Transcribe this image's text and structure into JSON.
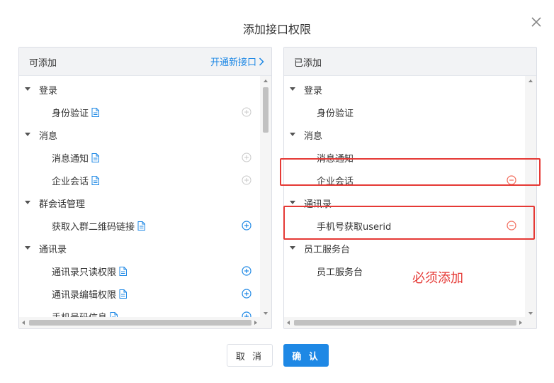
{
  "dialog": {
    "title": "添加接口权限",
    "cancel_label": "取 消",
    "confirm_label": "确 认"
  },
  "left_panel": {
    "title": "可添加",
    "open_link": "开通新接口",
    "items": [
      {
        "type": "parent",
        "label": "登录"
      },
      {
        "type": "child",
        "label": "身份验证",
        "action": "add-disabled"
      },
      {
        "type": "parent",
        "label": "消息"
      },
      {
        "type": "child",
        "label": "消息通知",
        "action": "add-disabled"
      },
      {
        "type": "child",
        "label": "企业会话",
        "action": "add-disabled"
      },
      {
        "type": "parent",
        "label": "群会话管理"
      },
      {
        "type": "child",
        "label": "获取入群二维码链接",
        "action": "add"
      },
      {
        "type": "parent",
        "label": "通讯录"
      },
      {
        "type": "child",
        "label": "通讯录只读权限",
        "action": "add"
      },
      {
        "type": "child",
        "label": "通讯录编辑权限",
        "action": "add"
      },
      {
        "type": "child",
        "label": "手机号码信息",
        "action": "add"
      }
    ]
  },
  "right_panel": {
    "title": "已添加",
    "items": [
      {
        "type": "parent",
        "label": "登录"
      },
      {
        "type": "child",
        "label": "身份验证",
        "action": "none"
      },
      {
        "type": "parent",
        "label": "消息"
      },
      {
        "type": "child",
        "label": "消息通知",
        "action": "none"
      },
      {
        "type": "child",
        "label": "企业会话",
        "action": "remove"
      },
      {
        "type": "parent",
        "label": "通讯录"
      },
      {
        "type": "child",
        "label": "手机号获取userid",
        "action": "remove"
      },
      {
        "type": "parent",
        "label": "员工服务台"
      },
      {
        "type": "child",
        "label": "员工服务台",
        "action": "none"
      }
    ]
  },
  "annotation": {
    "note": "必须添加",
    "color": "#e53935"
  },
  "colors": {
    "accent": "#1e88e5",
    "disabled": "#c8c8c8",
    "remove": "#f26b5b"
  }
}
